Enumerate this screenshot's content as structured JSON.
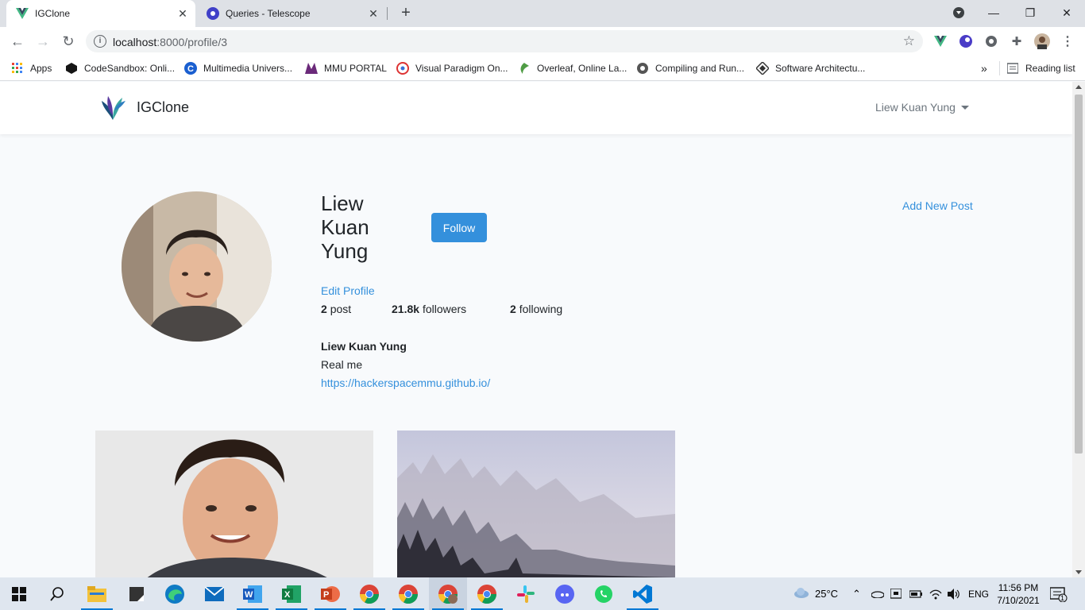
{
  "browser": {
    "tabs": [
      {
        "title": "IGClone",
        "icon": "vue-icon",
        "active": true
      },
      {
        "title": "Queries - Telescope",
        "icon": "telescope-icon",
        "active": false
      }
    ],
    "url_host": "localhost",
    "url_path": ":8000/profile/3",
    "bookmarks": [
      {
        "label": "Apps",
        "icon": "apps-grid-icon"
      },
      {
        "label": "CodeSandbox: Onli...",
        "icon": "codesandbox-icon"
      },
      {
        "label": "Multimedia Univers...",
        "icon": "mmu-c-icon"
      },
      {
        "label": "MMU PORTAL",
        "icon": "mmu-portal-icon"
      },
      {
        "label": "Visual Paradigm On...",
        "icon": "visual-paradigm-icon"
      },
      {
        "label": "Overleaf, Online La...",
        "icon": "overleaf-icon"
      },
      {
        "label": "Compiling and Run...",
        "icon": "compiler-icon"
      },
      {
        "label": "Software Architectu...",
        "icon": "architecture-icon"
      }
    ],
    "more_bookmarks": "»",
    "reading_list": "Reading list"
  },
  "app": {
    "brand": "IGClone",
    "user_menu": "Liew Kuan Yung"
  },
  "profile": {
    "name": "Liew Kuan Yung",
    "follow_label": "Follow",
    "add_post": "Add New Post",
    "edit_profile": "Edit Profile",
    "posts_count": "2",
    "posts_label": "post",
    "followers_count": "21.8k",
    "followers_label": "followers",
    "following_count": "2",
    "following_label": "following",
    "bio_title": "Liew Kuan Yung",
    "bio_text": "Real me",
    "bio_link": "https://hackerspacemmu.github.io/"
  },
  "posts": [
    {
      "alt": "portrait-photo"
    },
    {
      "alt": "misty-forest-photo"
    }
  ],
  "taskbar": {
    "weather": "25°C",
    "language": "ENG",
    "time": "11:56 PM",
    "date": "7/10/2021",
    "notification_count": "1"
  },
  "colors": {
    "accent": "#3490dc",
    "page_bg": "#f8fafc",
    "tab_strip": "#dee1e6",
    "taskbar": "#dfe6ef"
  }
}
